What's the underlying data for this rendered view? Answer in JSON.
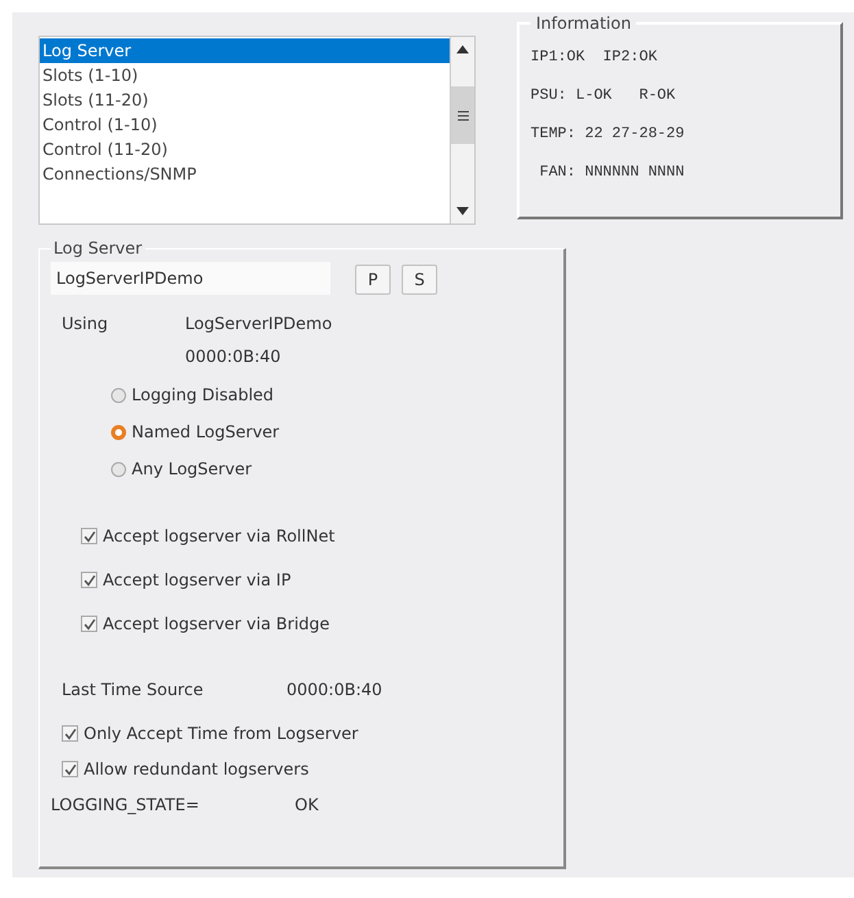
{
  "nav_list": {
    "items": [
      {
        "label": "Log Server",
        "selected": true
      },
      {
        "label": "Slots (1-10)",
        "selected": false
      },
      {
        "label": "Slots (11-20)",
        "selected": false
      },
      {
        "label": "Control (1-10)",
        "selected": false
      },
      {
        "label": "Control (11-20)",
        "selected": false
      },
      {
        "label": "Connections/SNMP",
        "selected": false
      }
    ]
  },
  "information": {
    "title": "Information",
    "lines": [
      "IP1:OK  IP2:OK",
      "PSU: L-OK   R-OK",
      "TEMP: 22 27-28-29",
      " FAN: NNNNNN NNNN"
    ]
  },
  "log_server": {
    "title": "Log Server",
    "server_field": {
      "value": "LogServerIPDemo"
    },
    "buttons": [
      "P",
      "S"
    ],
    "using_label": "Using",
    "using_name": "LogServerIPDemo",
    "using_address": "0000:0B:40",
    "modes": [
      {
        "label": "Logging Disabled",
        "selected": false
      },
      {
        "label": "Named LogServer",
        "selected": true
      },
      {
        "label": "Any LogServer",
        "selected": false
      }
    ],
    "accept_options": [
      {
        "label": "Accept logserver via RollNet",
        "checked": true
      },
      {
        "label": "Accept logserver via IP",
        "checked": true
      },
      {
        "label": "Accept logserver via Bridge",
        "checked": true
      }
    ],
    "last_time_source_label": "Last Time Source",
    "last_time_source_value": "0000:0B:40",
    "time_options": [
      {
        "label": "Only Accept Time from Logserver",
        "checked": true
      },
      {
        "label": "Allow redundant logservers",
        "checked": true
      }
    ],
    "state_label": "LOGGING_STATE=",
    "state_value": "OK"
  }
}
